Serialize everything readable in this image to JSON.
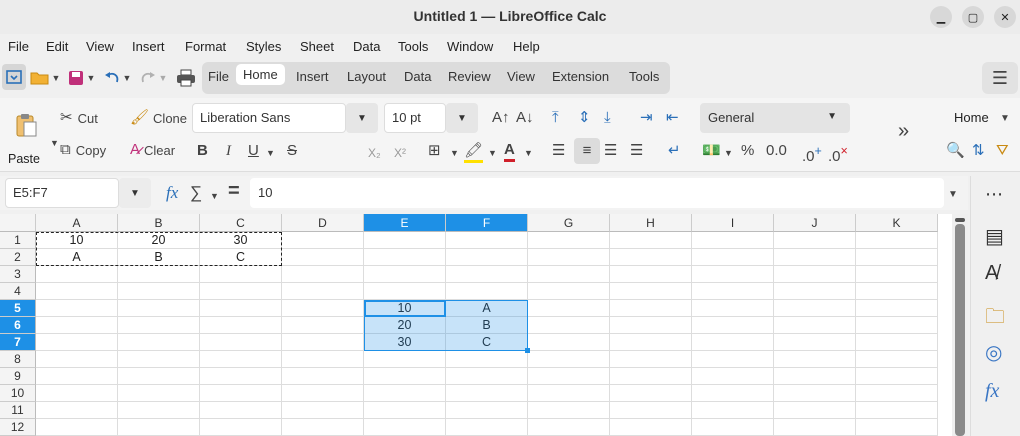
{
  "window": {
    "title": "Untitled 1 — LibreOffice Calc",
    "minimize": "▁",
    "maximize": "▢",
    "close": "✕"
  },
  "menubar": [
    "File",
    "Edit",
    "View",
    "Insert",
    "Format",
    "Styles",
    "Sheet",
    "Data",
    "Tools",
    "Window",
    "Help"
  ],
  "tabs": [
    "File",
    "Home",
    "Insert",
    "Layout",
    "Data",
    "Review",
    "View",
    "Extension",
    "Tools"
  ],
  "active_tab": "Home",
  "ribbon": {
    "paste": "Paste",
    "cut": "Cut",
    "copy": "Copy",
    "clone": "Clone",
    "clear": "Clear",
    "font_name": "Liberation Sans",
    "font_size": "10 pt",
    "bold": "B",
    "italic": "I",
    "underline": "U",
    "strike": "S",
    "subscript": "X₂",
    "superscript": "X²",
    "number_format": "General",
    "percent": "%",
    "decimal": "0.0",
    "more": "»",
    "sidebar_deck": "Home"
  },
  "formula": {
    "name_box": "E5:F7",
    "fx": "fx",
    "sum": "∑",
    "equals": "=",
    "content": "10"
  },
  "columns": [
    "A",
    "B",
    "C",
    "D",
    "E",
    "F",
    "G",
    "H",
    "I",
    "J",
    "K"
  ],
  "rows": [
    "1",
    "2",
    "3",
    "4",
    "5",
    "6",
    "7",
    "8",
    "9",
    "10",
    "11",
    "12"
  ],
  "cells": [
    {
      "col": "A",
      "row": "1",
      "v": "10"
    },
    {
      "col": "B",
      "row": "1",
      "v": "20"
    },
    {
      "col": "C",
      "row": "1",
      "v": "30"
    },
    {
      "col": "A",
      "row": "2",
      "v": "A"
    },
    {
      "col": "B",
      "row": "2",
      "v": "B"
    },
    {
      "col": "C",
      "row": "2",
      "v": "C"
    },
    {
      "col": "E",
      "row": "5",
      "v": "10"
    },
    {
      "col": "F",
      "row": "5",
      "v": "A"
    },
    {
      "col": "E",
      "row": "6",
      "v": "20"
    },
    {
      "col": "F",
      "row": "6",
      "v": "B"
    },
    {
      "col": "E",
      "row": "7",
      "v": "30"
    },
    {
      "col": "F",
      "row": "7",
      "v": "C"
    }
  ],
  "selection": {
    "cols": [
      "E",
      "F"
    ],
    "rows": [
      "5",
      "6",
      "7"
    ],
    "active": "E5"
  },
  "colors": {
    "accent": "#1e90e6",
    "sidebar_icon": "#3a76c4"
  }
}
